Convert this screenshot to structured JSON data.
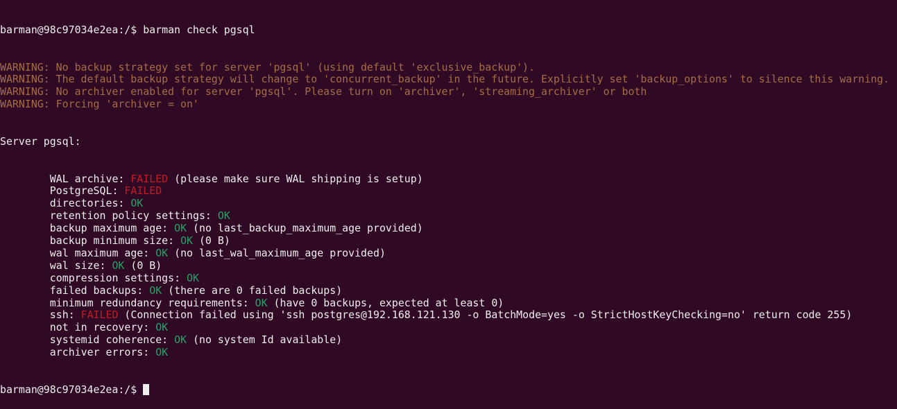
{
  "prompt": "barman@98c97034e2ea:/$ ",
  "command": "barman check pgsql",
  "warnings": [
    "WARNING: No backup strategy set for server 'pgsql' (using default 'exclusive_backup').",
    "WARNING: The default backup strategy will change to 'concurrent_backup' in the future. Explicitly set 'backup_options' to silence this warning.",
    "WARNING: No archiver enabled for server 'pgsql'. Please turn on 'archiver', 'streaming_archiver' or both",
    "WARNING: Forcing 'archiver = on'"
  ],
  "server_header": "Server pgsql:",
  "checks": [
    {
      "label": "WAL archive: ",
      "status": "FAILED",
      "kind": "fail",
      "detail": " (please make sure WAL shipping is setup)"
    },
    {
      "label": "PostgreSQL: ",
      "status": "FAILED",
      "kind": "fail",
      "detail": ""
    },
    {
      "label": "directories: ",
      "status": "OK",
      "kind": "ok",
      "detail": ""
    },
    {
      "label": "retention policy settings: ",
      "status": "OK",
      "kind": "ok",
      "detail": ""
    },
    {
      "label": "backup maximum age: ",
      "status": "OK",
      "kind": "ok",
      "detail": " (no last_backup_maximum_age provided)"
    },
    {
      "label": "backup minimum size: ",
      "status": "OK",
      "kind": "ok",
      "detail": " (0 B)"
    },
    {
      "label": "wal maximum age: ",
      "status": "OK",
      "kind": "ok",
      "detail": " (no last_wal_maximum_age provided)"
    },
    {
      "label": "wal size: ",
      "status": "OK",
      "kind": "ok",
      "detail": " (0 B)"
    },
    {
      "label": "compression settings: ",
      "status": "OK",
      "kind": "ok",
      "detail": ""
    },
    {
      "label": "failed backups: ",
      "status": "OK",
      "kind": "ok",
      "detail": " (there are 0 failed backups)"
    },
    {
      "label": "minimum redundancy requirements: ",
      "status": "OK",
      "kind": "ok",
      "detail": " (have 0 backups, expected at least 0)"
    },
    {
      "label": "ssh: ",
      "status": "FAILED",
      "kind": "fail",
      "detail": " (Connection failed using 'ssh postgres@192.168.121.130 -o BatchMode=yes -o StrictHostKeyChecking=no' return code 255)"
    },
    {
      "label": "not in recovery: ",
      "status": "OK",
      "kind": "ok",
      "detail": ""
    },
    {
      "label": "systemid coherence: ",
      "status": "OK",
      "kind": "ok",
      "detail": " (no system Id available)"
    },
    {
      "label": "archiver errors: ",
      "status": "OK",
      "kind": "ok",
      "detail": ""
    }
  ],
  "colors": {
    "background": "#300a24",
    "warning": "#a56d45",
    "failed": "#c01c28",
    "ok": "#26a269"
  }
}
